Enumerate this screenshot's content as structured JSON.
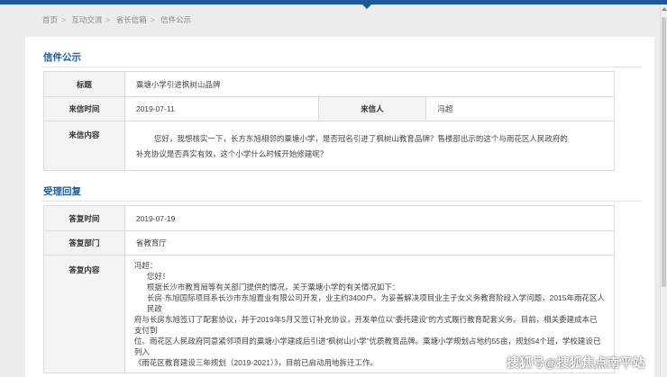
{
  "colors": {
    "accent": "#1a5a9c",
    "label_bg": "#f3f3f3"
  },
  "breadcrumb": {
    "items": [
      "首页",
      "互动交流",
      "省长信箱",
      "信件公示"
    ],
    "separator": ">"
  },
  "letter": {
    "section_title": "信件公示",
    "subject_label": "标题",
    "subject": "粟塘小学引进枫树山品牌",
    "date_label": "来信时间",
    "date": "2019-07-11",
    "sender_label": "来信人",
    "sender": "冯超",
    "content_label": "来信内容",
    "content_line1": "您好，我想核实一下，长方东旭相邻的粟塘小学，是否冠名引进了枫树山教育品牌？售楼部出示的这个与雨花区人民政府的",
    "content_line2": "补充协议是否真实有效，这个小学什么时候开始修建呢？"
  },
  "reply": {
    "section_title": "受理回复",
    "date_label": "答复时间",
    "date": "2019-07-19",
    "dept_label": "答复部门",
    "dept": "省教育厅",
    "content_label": "答复内容",
    "line1": "冯超：",
    "line2": "您好！",
    "line3": "根据长沙市教育局等有关部门提供的情况，关于粟塘小学的有关情况如下：",
    "line4": "长房·东旭国际项目系长沙市东旭置业有限公司开发，业主约3400户。为妥善解决项目业主子女义务教育阶段入学问题，2015年雨花区人民政",
    "line5": "府与长房东旭签订了配套协议，并于2019年5月又签订补充协议，开发单位以“委托建设”的方式履行教育配套义务。目前，相关委建成本已支付到",
    "line6": "位。雨花区人民政府同意紧邻项目的粟塘小学建成后引进“枫树山小学”优质教育品牌。粟塘小学规划占地约55亩，规划54个班，学校建设已列入",
    "line7": "《雨花区教育建设三年规划（2019-2021）》，目前已启动用地拆迁工作。"
  },
  "watermark": "搜狐号@搜狐焦点南平站"
}
